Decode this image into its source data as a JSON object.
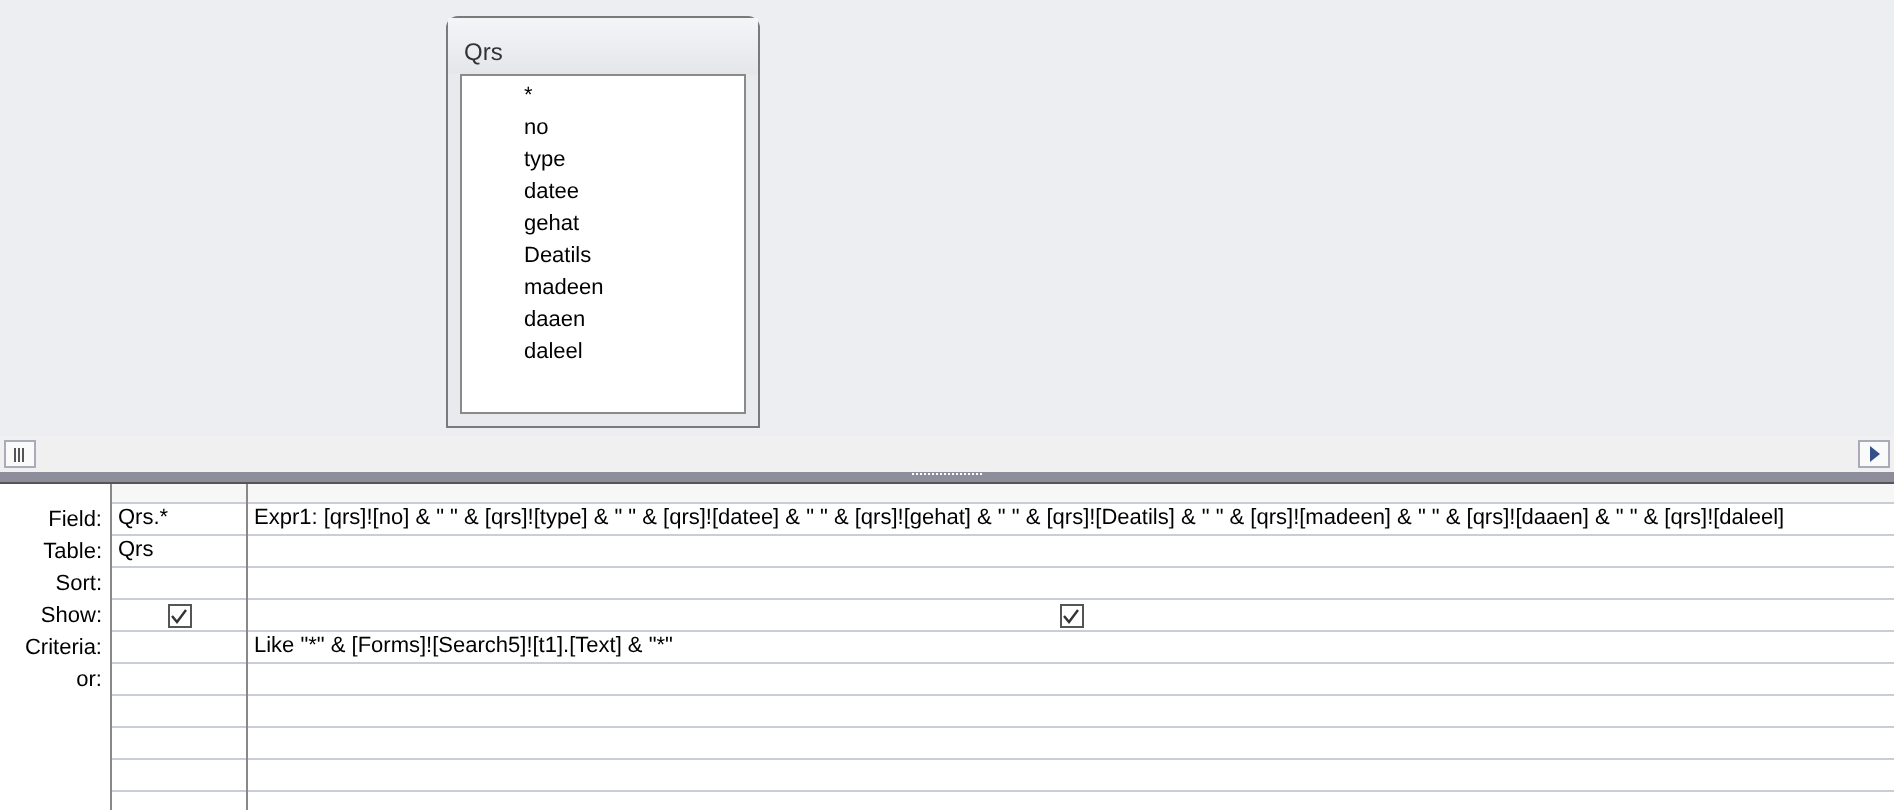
{
  "field_list": {
    "title": "Qrs",
    "fields": [
      "*",
      "no",
      "type",
      "datee",
      "gehat",
      "Deatils",
      "madeen",
      "daaen",
      "daleel"
    ]
  },
  "grid": {
    "row_labels": [
      "Field:",
      "Table:",
      "Sort:",
      "Show:",
      "Criteria:",
      "or:"
    ],
    "columns": [
      {
        "field": "Qrs.*",
        "table": "Qrs",
        "show": true
      },
      {
        "field": "Expr1: [qrs]![no] & \" \" & [qrs]![type] & \" \" & [qrs]![datee] & \" \" & [qrs]![gehat] & \" \" & [qrs]![Deatils] & \" \" & [qrs]![madeen] & \" \" & [qrs]![daaen] & \" \" & [qrs]![daleel]",
        "show": true,
        "criteria": "Like \"*\" & [Forms]![Search5]![t1].[Text] & \"*\""
      }
    ]
  }
}
